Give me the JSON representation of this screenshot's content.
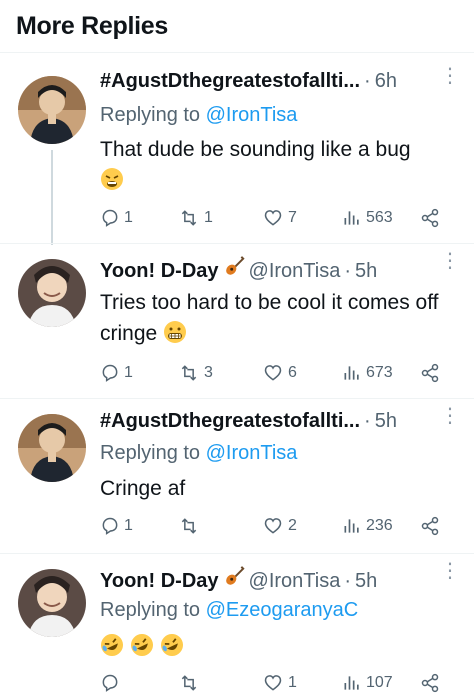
{
  "header": {
    "title": "More Replies"
  },
  "tweets": [
    {
      "name": "#AgustDthegreatestofallti...",
      "handle": "",
      "time": "6h",
      "reply_prefix": "Replying to",
      "reply_to": "@IronTisa",
      "text": "That dude be sounding like a bug",
      "emoji": "tired-face",
      "replies": "1",
      "retweets": "1",
      "likes": "7",
      "views": "563"
    },
    {
      "name": "Yoon! D-Day",
      "handle": "@IronTisa",
      "time": "5h",
      "text": "Tries too hard to be cool it comes off cringe",
      "emoji": "grimacing-face",
      "replies": "1",
      "retweets": "3",
      "likes": "6",
      "views": "673"
    },
    {
      "name": "#AgustDthegreatestofallti...",
      "handle": "",
      "time": "5h",
      "reply_prefix": "Replying to",
      "reply_to": "@IronTisa",
      "text": "Cringe af",
      "replies": "1",
      "retweets": "",
      "likes": "2",
      "views": "236"
    },
    {
      "name": "Yoon! D-Day",
      "handle": "@IronTisa",
      "time": "5h",
      "reply_prefix": "Replying to",
      "reply_to": "@EzeogaranyaC",
      "emoji": "rofl-x3",
      "replies": "",
      "retweets": "",
      "likes": "1",
      "views": "107"
    }
  ],
  "colors": {
    "link": "#1d9bf0",
    "secondary": "#536471",
    "line": "#cfd9de"
  }
}
